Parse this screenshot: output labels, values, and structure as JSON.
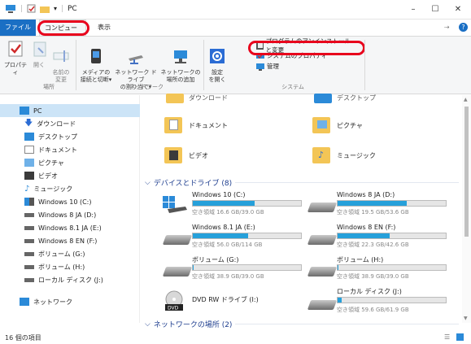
{
  "window": {
    "title": "PC",
    "minimize": "–",
    "maximize": "☐",
    "close": "✕"
  },
  "tabs": {
    "file": "ファイル",
    "computer": "コンピューター",
    "view": "表示"
  },
  "ribbon": {
    "buttons": [
      {
        "label": "プロパティ",
        "icon": "properties-icon"
      },
      {
        "label": "開く",
        "icon": "open-icon"
      },
      {
        "label": "名前の\n変更",
        "icon": "rename-icon"
      },
      {
        "label": "メディアの\n接続と切断▾",
        "icon": "media-icon"
      },
      {
        "label": "ネットワーク ドライブ\nの割り当て▾",
        "icon": "map-drive-icon"
      },
      {
        "label": "ネットワークの\n場所の追加",
        "icon": "add-network-icon"
      },
      {
        "label": "設定\nを開く",
        "icon": "settings-icon"
      }
    ],
    "system_items": [
      "プログラムのアンインストールと変更",
      "システムのプロパティ",
      "管理"
    ],
    "groups": [
      "場所",
      "ネットワーク",
      "システム"
    ]
  },
  "sidebar": {
    "items": [
      {
        "label": "PC",
        "icon": "pc-icon"
      },
      {
        "label": "ダウンロード",
        "icon": "download-icon"
      },
      {
        "label": "デスクトップ",
        "icon": "desktop-icon"
      },
      {
        "label": "ドキュメント",
        "icon": "documents-icon"
      },
      {
        "label": "ピクチャ",
        "icon": "pictures-icon"
      },
      {
        "label": "ビデオ",
        "icon": "videos-icon"
      },
      {
        "label": "ミュージック",
        "icon": "music-icon"
      },
      {
        "label": "Windows 10 (C:)",
        "icon": "windows-drive-icon"
      },
      {
        "label": "Windows 8 JA (D:)",
        "icon": "drive-icon"
      },
      {
        "label": "Windows 8.1 JA (E:)",
        "icon": "drive-icon"
      },
      {
        "label": "Windows 8 EN (F:)",
        "icon": "drive-icon"
      },
      {
        "label": "ボリューム (G:)",
        "icon": "drive-icon"
      },
      {
        "label": "ボリューム (H:)",
        "icon": "drive-icon"
      },
      {
        "label": "ローカル ディスク (J:)",
        "icon": "drive-icon"
      },
      {
        "label": "ネットワーク",
        "icon": "network-icon"
      }
    ]
  },
  "folders": {
    "top_left": "ダウンロード",
    "top_right": "デスクトップ",
    "documents": "ドキュメント",
    "pictures": "ピクチャ",
    "videos": "ビデオ",
    "music": "ミュージック"
  },
  "drives_header": "デバイスとドライブ (8)",
  "drives": [
    {
      "name": "Windows 10 (C:)",
      "free": "空き領域 16.6 GB/39.0 GB",
      "used": 0.57
    },
    {
      "name": "Windows 8 JA (D:)",
      "free": "空き領域 19.5 GB/53.6 GB",
      "used": 0.64
    },
    {
      "name": "Windows 8.1 JA (E:)",
      "free": "空き領域 56.0 GB/114 GB",
      "used": 0.51
    },
    {
      "name": "Windows 8 EN (F:)",
      "free": "空き領域 22.3 GB/42.6 GB",
      "used": 0.48
    },
    {
      "name": "ボリューム (G:)",
      "free": "空き領域 38.9 GB/39.0 GB",
      "used": 0.01
    },
    {
      "name": "ボリューム (H:)",
      "free": "空き領域 38.9 GB/39.0 GB",
      "used": 0.01
    },
    {
      "name": "DVD RW ドライブ (I:)",
      "free": "",
      "used": null
    },
    {
      "name": "ローカル ディスク (J:)",
      "free": "空き領域 59.6 GB/61.9 GB",
      "used": 0.04
    }
  ],
  "network_header": "ネットワークの場所 (2)",
  "status": {
    "count": "16 個の項目"
  },
  "colors": {
    "accent": "#1a6fc4",
    "highlight": "#e8001c",
    "bar": "#26a0da"
  }
}
